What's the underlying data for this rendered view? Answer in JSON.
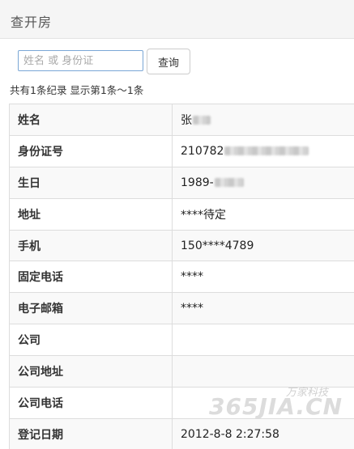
{
  "header": {
    "title": "查开房"
  },
  "search": {
    "placeholder": "姓名 或 身份证",
    "value": "",
    "button_label": "查询"
  },
  "summary": "共有1条纪录 显示第1条～1条",
  "record": [
    {
      "label": "姓名",
      "value": "张",
      "redacted": true
    },
    {
      "label": "身份证号",
      "value": "210782",
      "redacted": true
    },
    {
      "label": "生日",
      "value": "1989-",
      "redacted": true
    },
    {
      "label": "地址",
      "value": "****待定",
      "redacted": false
    },
    {
      "label": "手机",
      "value": "150****4789",
      "redacted": false
    },
    {
      "label": "固定电话",
      "value": "****",
      "redacted": false
    },
    {
      "label": "电子邮箱",
      "value": "****",
      "redacted": false
    },
    {
      "label": "公司",
      "value": "",
      "redacted": false
    },
    {
      "label": "公司地址",
      "value": "",
      "redacted": false
    },
    {
      "label": "公司电话",
      "value": "",
      "redacted": false
    },
    {
      "label": "登记日期",
      "value": "2012-8-8 2:27:58",
      "redacted": false
    }
  ],
  "watermark": {
    "small": "万家科技",
    "main": "365JIA.CN"
  }
}
